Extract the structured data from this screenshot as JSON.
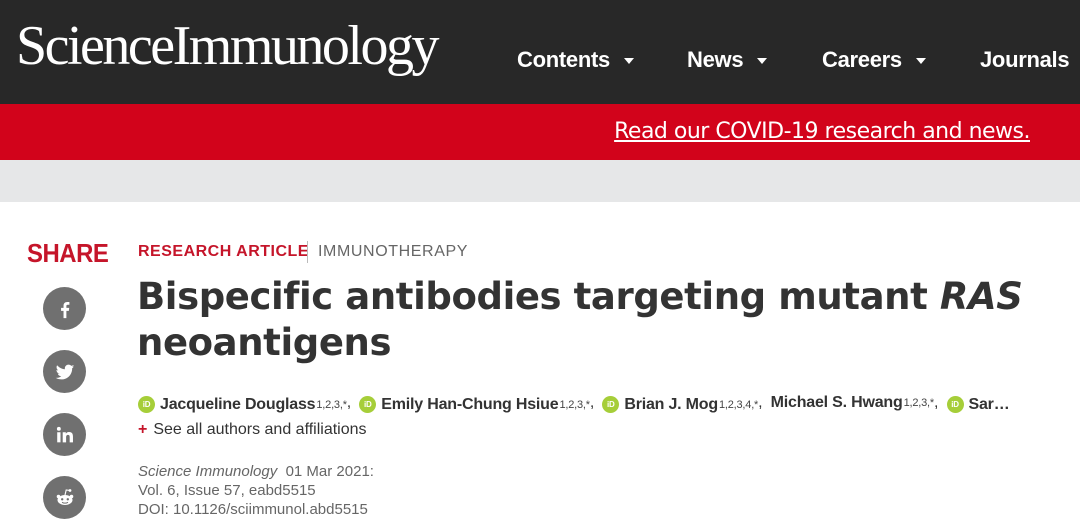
{
  "header": {
    "logo": "ScienceImmunology",
    "nav": [
      {
        "label": "Contents"
      },
      {
        "label": "News"
      },
      {
        "label": "Careers"
      },
      {
        "label": "Journals"
      }
    ]
  },
  "banner": {
    "link_text": "Read our COVID-19 research and news."
  },
  "share": {
    "title": "SHARE",
    "buttons": [
      "facebook-icon",
      "twitter-icon",
      "linkedin-icon",
      "reddit-icon"
    ]
  },
  "article": {
    "type": "RESEARCH ARTICLE",
    "subject": "IMMUNOTHERAPY",
    "title_part1": "Bispecific antibodies targeting mutant ",
    "title_italic": "RAS",
    "title_part2": "neoantigens",
    "authors": [
      {
        "name": "Jacqueline Douglass",
        "aff": "1,2,3,*",
        "orcid": true
      },
      {
        "name": "Emily Han-Chung Hsiue",
        "aff": "1,2,3,*",
        "orcid": true
      },
      {
        "name": "Brian J. Mog",
        "aff": "1,2,3,4,*",
        "orcid": true
      },
      {
        "name": "Michael S. Hwang",
        "aff": "1,2,3,*",
        "orcid": false
      },
      {
        "name": "Sar…",
        "aff": "",
        "orcid": true
      }
    ],
    "see_all": "See all authors and affiliations",
    "journal": "Science Immunology",
    "date": "01 Mar 2021:",
    "volume": "Vol. 6, Issue 57, eabd5515",
    "doi": "DOI: 10.1126/sciimmunol.abd5515"
  },
  "colors": {
    "header_bg": "#282828",
    "banner_red": "#d2031b",
    "accent_red": "#c5152a",
    "orcid_green": "#a6ce39",
    "share_grey": "#707070"
  }
}
